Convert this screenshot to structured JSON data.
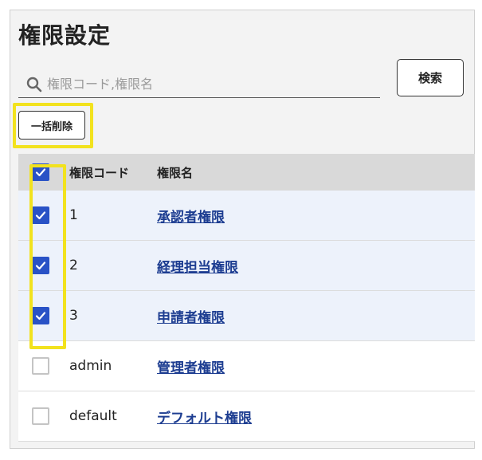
{
  "page": {
    "title": "権限設定"
  },
  "search": {
    "placeholder": "権限コード,権限名",
    "value": "",
    "button_label": "検索"
  },
  "toolbar": {
    "bulk_delete_label": "一括削除"
  },
  "table": {
    "headers": {
      "code": "権限コード",
      "name": "権限名"
    },
    "header_checked": true,
    "rows": [
      {
        "code": "1",
        "name": "承認者権限",
        "checked": true
      },
      {
        "code": "2",
        "name": "経理担当権限",
        "checked": true
      },
      {
        "code": "3",
        "name": "申請者権限",
        "checked": true
      },
      {
        "code": "admin",
        "name": "管理者権限",
        "checked": false
      },
      {
        "code": "default",
        "name": "デフォルト権限",
        "checked": false
      }
    ]
  },
  "colors": {
    "accent": "#2952c6",
    "link": "#1d3d91",
    "highlight": "#f2e21e",
    "selected_row": "#edf2fb",
    "header_bg": "#d9d9d9"
  }
}
